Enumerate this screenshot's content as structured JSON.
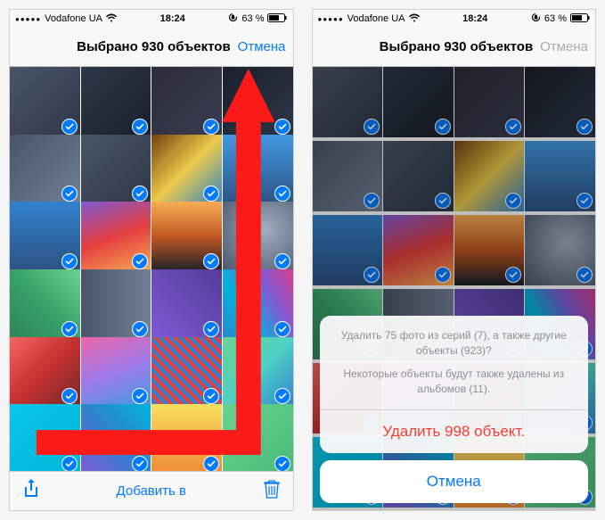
{
  "status": {
    "carrier": "Vodafone UA",
    "wifi_icon": "wifi",
    "time": "18:24",
    "orientation_icon": "lock-rotate",
    "battery_pct": "63 %",
    "battery_icon": "battery"
  },
  "left": {
    "nav": {
      "title": "Выбрано 930 объектов",
      "cancel": "Отмена"
    },
    "toolbar": {
      "share": "share-icon",
      "add_to": "Добавить в",
      "trash": "trash-icon"
    }
  },
  "right": {
    "nav": {
      "title": "Выбрано 930 объектов",
      "cancel": "Отмена"
    },
    "sheet": {
      "msg1": "Удалить 75 фото из серий (7), а также другие объекты (923)?",
      "msg2": "Некоторые объекты будут также удалены из альбомов (11).",
      "delete": "Удалить 998 объект.",
      "cancel": "Отмена"
    }
  },
  "grid_classes": [
    "c1",
    "c2",
    "c3",
    "c4",
    "c5",
    "c6",
    "c7",
    "c8",
    "c9",
    "c10",
    "c11",
    "c12",
    "c13",
    "c14",
    "c15",
    "c16",
    "c17",
    "c18",
    "c19",
    "c20",
    "c21",
    "c22",
    "c23",
    "c24"
  ]
}
